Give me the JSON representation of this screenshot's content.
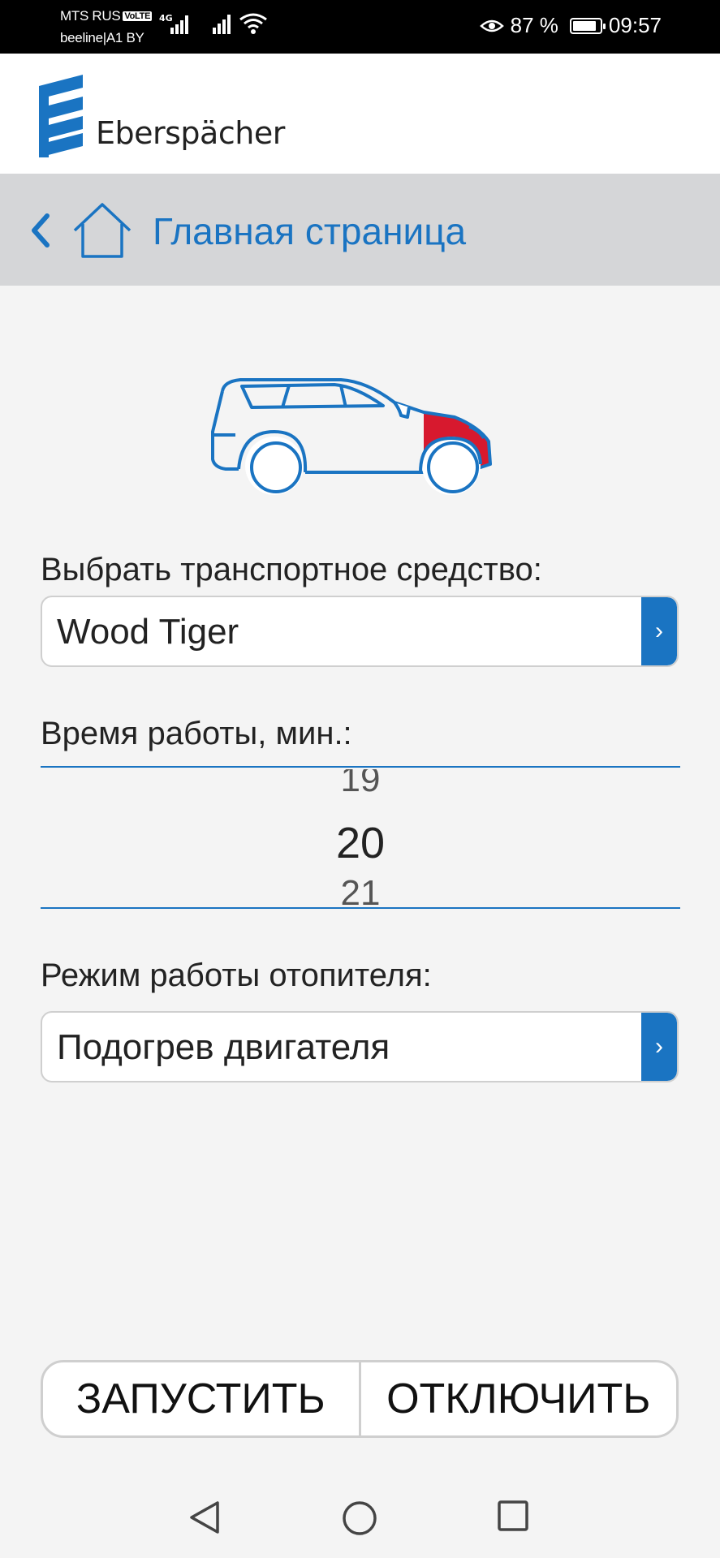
{
  "status_bar": {
    "carrier1": "MTS RUS",
    "volte": "VoLTE",
    "network": "4G",
    "carrier2": "beeline|A1 BY",
    "battery": "87 %",
    "battery_level": 0.87,
    "time": "09:57"
  },
  "header": {
    "brand": "Eberspächer"
  },
  "nav": {
    "title": "Главная страница"
  },
  "vehicle": {
    "label": "Выбрать транспортное средство:",
    "value": "Wood Tiger"
  },
  "runtime": {
    "label": "Время работы, мин.:",
    "prev": "19",
    "current": "20",
    "next": "21"
  },
  "mode": {
    "label": "Режим работы отопителя:",
    "value": "Подогрев двигателя"
  },
  "actions": {
    "start": "ЗАПУСТИТЬ",
    "stop": "ОТКЛЮЧИТЬ"
  },
  "colors": {
    "accent": "#1a74c2",
    "highlight": "#d7192e"
  }
}
